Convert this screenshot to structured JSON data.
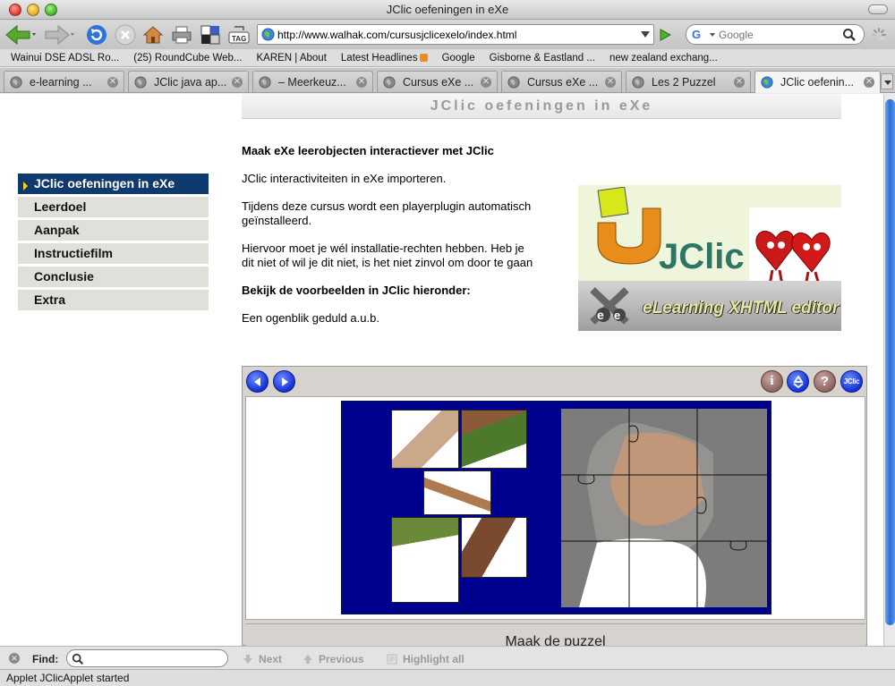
{
  "window": {
    "title": "JClic oefeningen in eXe"
  },
  "toolbar": {
    "url": "http://www.walhak.com/cursusjclicexelo/index.html",
    "search_placeholder": "Google",
    "tag_label": "TAG"
  },
  "bookmarks": [
    {
      "label": "Wainui DSE ADSL Ro..."
    },
    {
      "label": "(25) RoundCube Web..."
    },
    {
      "label": "KAREN | About"
    },
    {
      "label": "Latest Headlines"
    },
    {
      "label": "Google"
    },
    {
      "label": "Gisborne & Eastland ..."
    },
    {
      "label": "new zealand exchang..."
    }
  ],
  "tabs": [
    {
      "label": "e-learning ...",
      "active": false
    },
    {
      "label": "JClic java ap...",
      "active": false
    },
    {
      "label": "– Meerkeuz...",
      "active": false
    },
    {
      "label": "Cursus eXe ...",
      "active": false
    },
    {
      "label": "Cursus eXe ...",
      "active": false
    },
    {
      "label": "Les 2 Puzzel",
      "active": false
    },
    {
      "label": "JClic oefenin...",
      "active": true
    }
  ],
  "page": {
    "header": "JClic oefeningen in eXe",
    "menu": [
      {
        "label": "JClic oefeningen in eXe",
        "active": true
      },
      {
        "label": "Leerdoel",
        "active": false
      },
      {
        "label": "Aanpak",
        "active": false
      },
      {
        "label": "Instructiefilm",
        "active": false
      },
      {
        "label": "Conclusie",
        "active": false
      },
      {
        "label": "Extra",
        "active": false
      }
    ],
    "heading": "Maak eXe leerobjecten interactiever met JClic",
    "p1": "JClic interactiviteiten in eXe importeren.",
    "p2": "Tijdens deze cursus wordt een playerplugin automatisch geïnstalleerd.",
    "p3": "Hiervoor moet je wél installatie-rechten hebben. Heb je dit niet of wil je dit niet, is het niet zinvol om door te gaan",
    "sub": "Bekijk de voorbeelden in JClic hieronder:",
    "p4": "Een ogenblik geduld a.u.b.",
    "banner": {
      "logo_text": "JClic",
      "editor_text": "eLearning XHTML editor"
    }
  },
  "applet": {
    "buttons": {
      "info": "i",
      "help": "?",
      "brand": "JClic"
    },
    "message": "Maak de puzzel"
  },
  "findbar": {
    "label": "Find:",
    "next": "Next",
    "previous": "Previous",
    "highlight": "Highlight all"
  },
  "status": {
    "text": "Applet JClicApplet started"
  }
}
